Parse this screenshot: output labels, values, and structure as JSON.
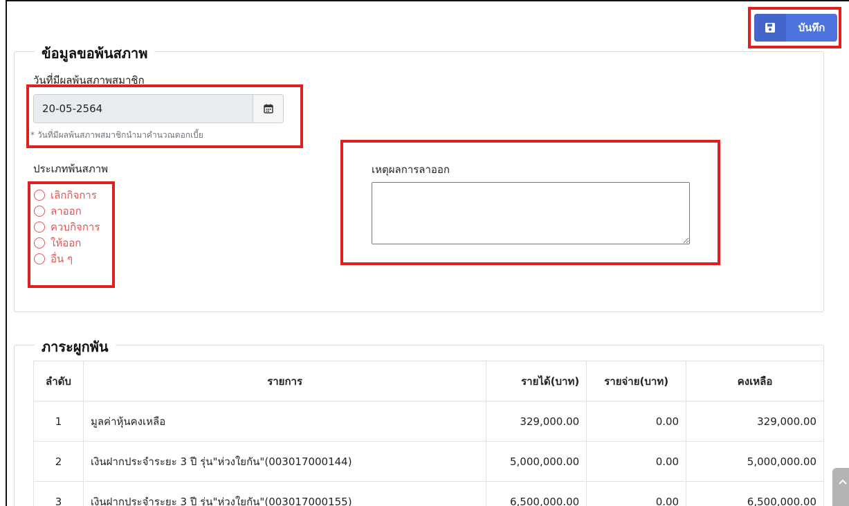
{
  "toolbar": {
    "save_label": "บันทึก",
    "save_icon": "floppy-disk-icon"
  },
  "membership_section": {
    "legend": "ข้อมูลขอพ้นสภาพ",
    "effective_date": {
      "label": "วันที่มีผลพ้นสภาพสมาชิก",
      "value": "20-05-2564",
      "hint": "* วันที่มีผลพ้นสภาพสมาชิกนำมาคำนวณดอกเบี้ย"
    },
    "type": {
      "label": "ประเภทพ้นสภาพ",
      "options": [
        "เลิกกิจการ",
        "ลาออก",
        "ควบกิจการ",
        "ให้ออก",
        "อื่น ๆ"
      ]
    },
    "reason": {
      "label": "เหตุผลการลาออก",
      "value": ""
    }
  },
  "obligations_section": {
    "legend": "ภาระผูกพัน",
    "columns": [
      "ลำดับ",
      "รายการ",
      "รายได้(บาท)",
      "รายจ่าย(บาท)",
      "คงเหลือ"
    ],
    "rows": [
      [
        "1",
        "มูลค่าหุ้นคงเหลือ",
        "329,000.00",
        "0.00",
        "329,000.00"
      ],
      [
        "2",
        "เงินฝากประจำระยะ 3 ปี รุ่น\"ห่วงใยกัน\"(003017000144)",
        "5,000,000.00",
        "0.00",
        "5,000,000.00"
      ],
      [
        "3",
        "เงินฝากประจำระยะ 3 ปี รุ่น\"ห่วงใยกัน\"(003017000155)",
        "6,500,000.00",
        "0.00",
        "6,500,000.00"
      ]
    ]
  },
  "colors": {
    "accent": "#4e73df",
    "highlight": "#e02020",
    "radio": "#e25555"
  }
}
